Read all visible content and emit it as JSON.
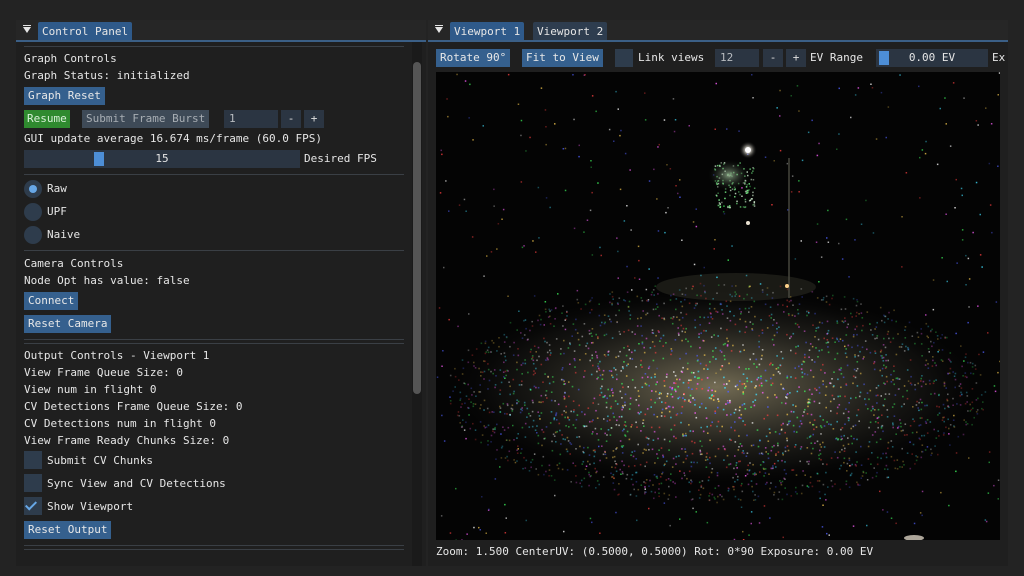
{
  "control_panel": {
    "tab_label": "Control Panel",
    "graph": {
      "heading": "Graph Controls",
      "status": "Graph Status: initialized",
      "reset_label": "Graph Reset",
      "resume_label": "Resume",
      "burst_label": "Submit Frame Burst",
      "burst_value": "1",
      "minus": "-",
      "plus": "+",
      "gui_update": "GUI update average 16.674 ms/frame (60.0 FPS)",
      "fps_value": "15",
      "fps_fraction": 0.26,
      "fps_label": "Desired FPS"
    },
    "modes": [
      {
        "label": "Raw",
        "selected": true
      },
      {
        "label": "UPF",
        "selected": false
      },
      {
        "label": "Naive",
        "selected": false
      }
    ],
    "camera": {
      "heading": "Camera Controls",
      "node_opt": "Node Opt has value: false",
      "connect_label": "Connect",
      "reset_label": "Reset Camera"
    },
    "output": {
      "heading": "Output Controls - Viewport 1",
      "lines": [
        "View Frame Queue Size: 0",
        "View num in flight 0",
        "CV Detections Frame Queue Size: 0",
        "CV Detections num in flight 0",
        "View Frame Ready Chunks Size: 0"
      ],
      "checkboxes": [
        {
          "label": "Submit CV Chunks",
          "checked": false
        },
        {
          "label": "Sync View and CV Detections",
          "checked": false
        },
        {
          "label": "Show Viewport",
          "checked": true
        }
      ],
      "reset_label": "Reset Output"
    }
  },
  "viewport_panel": {
    "tabs": [
      "Viewport 1",
      "Viewport 2"
    ],
    "toolbar": {
      "rotate_label": "Rotate 90°",
      "fit_label": "Fit to View",
      "link_label": "Link views",
      "link_value": "12",
      "minus": "-",
      "plus": "+",
      "ev_range_label": "EV Range",
      "ev_value": "0.00 EV",
      "overflow": "Ex"
    },
    "status_bar": "Zoom: 1.500  CenterUV: (0.5000, 0.5000)  Rot: 0*90  Exposure: 0.00 EV"
  }
}
